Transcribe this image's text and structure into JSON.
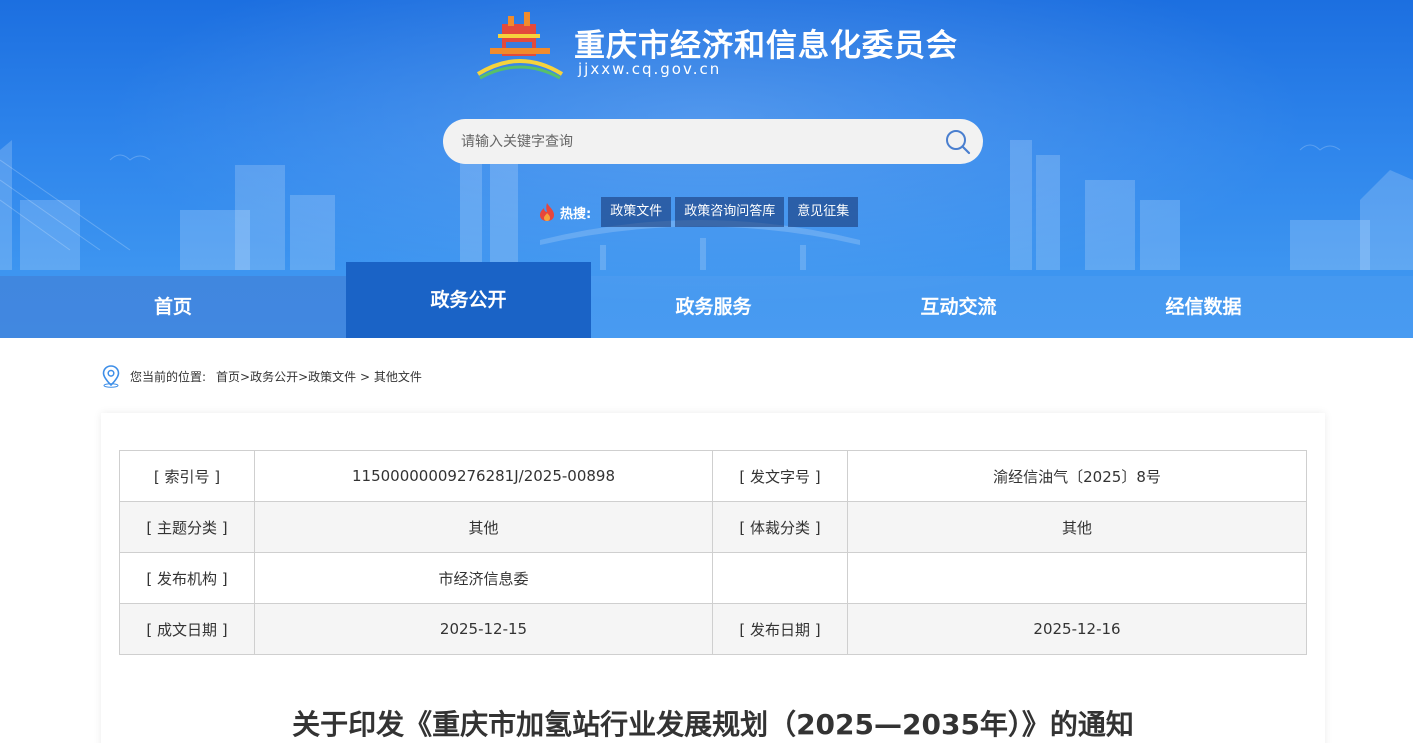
{
  "header": {
    "site_title": "重庆市经济和信息化委员会",
    "site_domain": "jjxxw.cq.gov.cn",
    "search_placeholder": "请输入关键字查询",
    "hot_label": "热搜:",
    "hot_tags": [
      "政策文件",
      "政策咨询问答库",
      "意见征集"
    ],
    "colors": {
      "primary": "#2f86ec",
      "nav_active": "#1a63c6"
    }
  },
  "nav": {
    "items": [
      "首页",
      "政务公开",
      "政务服务",
      "互动交流",
      "经信数据"
    ],
    "active": "政务公开"
  },
  "breadcrumb": {
    "label": "您当前的位置:",
    "path": "首页>政务公开>政策文件 > 其他文件"
  },
  "meta_table": {
    "rows": [
      {
        "k1": "[ 索引号 ]",
        "v1": "11500000009276281J/2025-00898",
        "k2": "[ 发文字号 ]",
        "v2": "渝经信油气〔2025〕8号"
      },
      {
        "k1": "[ 主题分类 ]",
        "v1": "其他",
        "k2": "[ 体裁分类 ]",
        "v2": "其他"
      },
      {
        "k1": "[ 发布机构 ]",
        "v1": "市经济信息委",
        "k2": "",
        "v2": ""
      },
      {
        "k1": "[ 成文日期 ]",
        "v1": "2025-12-15",
        "k2": "[ 发布日期 ]",
        "v2": "2025-12-16"
      }
    ]
  },
  "document": {
    "title": "关于印发《重庆市加氢站行业发展规划（2025—2035年）》的通知"
  }
}
